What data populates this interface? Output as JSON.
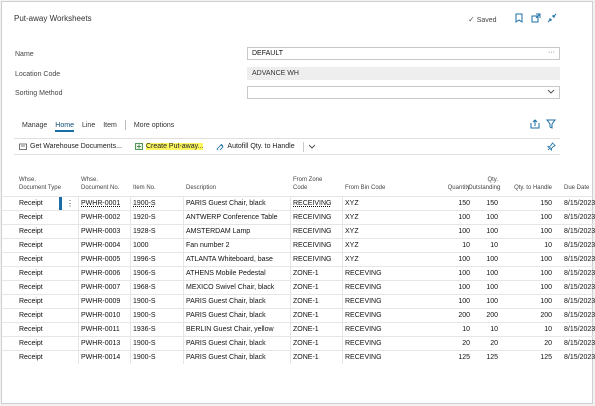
{
  "header": {
    "title": "Put-away Worksheets",
    "saved_label": "Saved"
  },
  "form": {
    "name_label": "Name",
    "name_value": "DEFAULT",
    "location_label": "Location Code",
    "location_value": "ADVANCE WH",
    "sorting_label": "Sorting Method",
    "sorting_value": ""
  },
  "tabs": [
    "Manage",
    "Home",
    "Line",
    "Item",
    "More options"
  ],
  "actions": {
    "get_docs": "Get Warehouse Documents...",
    "create_putaway": "Create Put-away...",
    "autofill": "Autofill Qty. to Handle"
  },
  "columns": {
    "doc_type": "Whse. Document Type",
    "doc_no": "Whse. Document No.",
    "item_no": "Item No.",
    "description": "Description",
    "from_zone": "From Zone Code",
    "from_bin": "From Bin Code",
    "quantity": "Quantity",
    "qty_outstanding": "Qty. Outstanding",
    "qty_to_handle": "Qty. to Handle",
    "due_date": "Due Date"
  },
  "rows": [
    {
      "type": "Receipt",
      "doc": "PWHR-0001",
      "item": "1900-S",
      "desc": "PARIS Guest Chair, black",
      "zone": "RECEIVING",
      "bin": "XYZ",
      "qty": "150",
      "out": "150",
      "handle": "150",
      "due": "8/15/2023"
    },
    {
      "type": "Receipt",
      "doc": "PWHR-0002",
      "item": "1920-S",
      "desc": "ANTWERP Conference Table",
      "zone": "RECEIVING",
      "bin": "XYZ",
      "qty": "100",
      "out": "100",
      "handle": "100",
      "due": "8/15/2023"
    },
    {
      "type": "Receipt",
      "doc": "PWHR-0003",
      "item": "1928-S",
      "desc": "AMSTERDAM Lamp",
      "zone": "RECEIVING",
      "bin": "XYZ",
      "qty": "100",
      "out": "100",
      "handle": "100",
      "due": "8/15/2023"
    },
    {
      "type": "Receipt",
      "doc": "PWHR-0004",
      "item": "1000",
      "desc": "Fan number 2",
      "zone": "RECEIVING",
      "bin": "XYZ",
      "qty": "10",
      "out": "10",
      "handle": "10",
      "due": "8/15/2023"
    },
    {
      "type": "Receipt",
      "doc": "PWHR-0005",
      "item": "1996-S",
      "desc": "ATLANTA Whiteboard, base",
      "zone": "RECEIVING",
      "bin": "XYZ",
      "qty": "100",
      "out": "100",
      "handle": "100",
      "due": "8/15/2023"
    },
    {
      "type": "Receipt",
      "doc": "PWHR-0006",
      "item": "1906-S",
      "desc": "ATHENS Mobile Pedestal",
      "zone": "ZONE-1",
      "bin": "RECEVING",
      "qty": "100",
      "out": "100",
      "handle": "100",
      "due": "8/15/2023"
    },
    {
      "type": "Receipt",
      "doc": "PWHR-0007",
      "item": "1968-S",
      "desc": "MEXICO Swivel Chair, black",
      "zone": "ZONE-1",
      "bin": "RECEVING",
      "qty": "100",
      "out": "100",
      "handle": "100",
      "due": "8/15/2023"
    },
    {
      "type": "Receipt",
      "doc": "PWHR-0009",
      "item": "1900-S",
      "desc": "PARIS Guest Chair, black",
      "zone": "ZONE-1",
      "bin": "RECEVING",
      "qty": "100",
      "out": "100",
      "handle": "100",
      "due": "8/15/2023"
    },
    {
      "type": "Receipt",
      "doc": "PWHR-0010",
      "item": "1900-S",
      "desc": "PARIS Guest Chair, black",
      "zone": "ZONE-1",
      "bin": "RECEVING",
      "qty": "200",
      "out": "200",
      "handle": "200",
      "due": "8/15/2023"
    },
    {
      "type": "Receipt",
      "doc": "PWHR-0011",
      "item": "1936-S",
      "desc": "BERLIN Guest Chair, yellow",
      "zone": "ZONE-1",
      "bin": "RECEVING",
      "qty": "10",
      "out": "10",
      "handle": "10",
      "due": "8/15/2023"
    },
    {
      "type": "Receipt",
      "doc": "PWHR-0013",
      "item": "1900-S",
      "desc": "PARIS Guest Chair, black",
      "zone": "ZONE-1",
      "bin": "RECEVING",
      "qty": "20",
      "out": "20",
      "handle": "20",
      "due": "8/15/2023"
    },
    {
      "type": "Receipt",
      "doc": "PWHR-0014",
      "item": "1900-S",
      "desc": "PARIS Guest Chair, black",
      "zone": "ZONE-1",
      "bin": "RECEVING",
      "qty": "125",
      "out": "125",
      "handle": "125",
      "due": "8/15/2023"
    }
  ],
  "colors": {
    "accent": "#1b6ea5",
    "highlight": "#fbf560"
  }
}
